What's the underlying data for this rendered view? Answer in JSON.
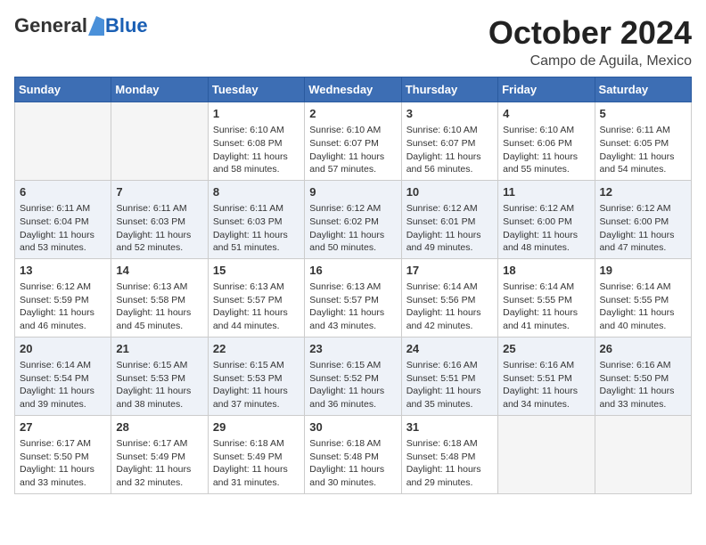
{
  "logo": {
    "general": "General",
    "blue": "Blue"
  },
  "header": {
    "month": "October 2024",
    "location": "Campo de Aguila, Mexico"
  },
  "days_of_week": [
    "Sunday",
    "Monday",
    "Tuesday",
    "Wednesday",
    "Thursday",
    "Friday",
    "Saturday"
  ],
  "weeks": [
    [
      {
        "day": "",
        "empty": true
      },
      {
        "day": "",
        "empty": true
      },
      {
        "day": "1",
        "sunrise": "Sunrise: 6:10 AM",
        "sunset": "Sunset: 6:08 PM",
        "daylight": "Daylight: 11 hours and 58 minutes."
      },
      {
        "day": "2",
        "sunrise": "Sunrise: 6:10 AM",
        "sunset": "Sunset: 6:07 PM",
        "daylight": "Daylight: 11 hours and 57 minutes."
      },
      {
        "day": "3",
        "sunrise": "Sunrise: 6:10 AM",
        "sunset": "Sunset: 6:07 PM",
        "daylight": "Daylight: 11 hours and 56 minutes."
      },
      {
        "day": "4",
        "sunrise": "Sunrise: 6:10 AM",
        "sunset": "Sunset: 6:06 PM",
        "daylight": "Daylight: 11 hours and 55 minutes."
      },
      {
        "day": "5",
        "sunrise": "Sunrise: 6:11 AM",
        "sunset": "Sunset: 6:05 PM",
        "daylight": "Daylight: 11 hours and 54 minutes."
      }
    ],
    [
      {
        "day": "6",
        "sunrise": "Sunrise: 6:11 AM",
        "sunset": "Sunset: 6:04 PM",
        "daylight": "Daylight: 11 hours and 53 minutes."
      },
      {
        "day": "7",
        "sunrise": "Sunrise: 6:11 AM",
        "sunset": "Sunset: 6:03 PM",
        "daylight": "Daylight: 11 hours and 52 minutes."
      },
      {
        "day": "8",
        "sunrise": "Sunrise: 6:11 AM",
        "sunset": "Sunset: 6:03 PM",
        "daylight": "Daylight: 11 hours and 51 minutes."
      },
      {
        "day": "9",
        "sunrise": "Sunrise: 6:12 AM",
        "sunset": "Sunset: 6:02 PM",
        "daylight": "Daylight: 11 hours and 50 minutes."
      },
      {
        "day": "10",
        "sunrise": "Sunrise: 6:12 AM",
        "sunset": "Sunset: 6:01 PM",
        "daylight": "Daylight: 11 hours and 49 minutes."
      },
      {
        "day": "11",
        "sunrise": "Sunrise: 6:12 AM",
        "sunset": "Sunset: 6:00 PM",
        "daylight": "Daylight: 11 hours and 48 minutes."
      },
      {
        "day": "12",
        "sunrise": "Sunrise: 6:12 AM",
        "sunset": "Sunset: 6:00 PM",
        "daylight": "Daylight: 11 hours and 47 minutes."
      }
    ],
    [
      {
        "day": "13",
        "sunrise": "Sunrise: 6:12 AM",
        "sunset": "Sunset: 5:59 PM",
        "daylight": "Daylight: 11 hours and 46 minutes."
      },
      {
        "day": "14",
        "sunrise": "Sunrise: 6:13 AM",
        "sunset": "Sunset: 5:58 PM",
        "daylight": "Daylight: 11 hours and 45 minutes."
      },
      {
        "day": "15",
        "sunrise": "Sunrise: 6:13 AM",
        "sunset": "Sunset: 5:57 PM",
        "daylight": "Daylight: 11 hours and 44 minutes."
      },
      {
        "day": "16",
        "sunrise": "Sunrise: 6:13 AM",
        "sunset": "Sunset: 5:57 PM",
        "daylight": "Daylight: 11 hours and 43 minutes."
      },
      {
        "day": "17",
        "sunrise": "Sunrise: 6:14 AM",
        "sunset": "Sunset: 5:56 PM",
        "daylight": "Daylight: 11 hours and 42 minutes."
      },
      {
        "day": "18",
        "sunrise": "Sunrise: 6:14 AM",
        "sunset": "Sunset: 5:55 PM",
        "daylight": "Daylight: 11 hours and 41 minutes."
      },
      {
        "day": "19",
        "sunrise": "Sunrise: 6:14 AM",
        "sunset": "Sunset: 5:55 PM",
        "daylight": "Daylight: 11 hours and 40 minutes."
      }
    ],
    [
      {
        "day": "20",
        "sunrise": "Sunrise: 6:14 AM",
        "sunset": "Sunset: 5:54 PM",
        "daylight": "Daylight: 11 hours and 39 minutes."
      },
      {
        "day": "21",
        "sunrise": "Sunrise: 6:15 AM",
        "sunset": "Sunset: 5:53 PM",
        "daylight": "Daylight: 11 hours and 38 minutes."
      },
      {
        "day": "22",
        "sunrise": "Sunrise: 6:15 AM",
        "sunset": "Sunset: 5:53 PM",
        "daylight": "Daylight: 11 hours and 37 minutes."
      },
      {
        "day": "23",
        "sunrise": "Sunrise: 6:15 AM",
        "sunset": "Sunset: 5:52 PM",
        "daylight": "Daylight: 11 hours and 36 minutes."
      },
      {
        "day": "24",
        "sunrise": "Sunrise: 6:16 AM",
        "sunset": "Sunset: 5:51 PM",
        "daylight": "Daylight: 11 hours and 35 minutes."
      },
      {
        "day": "25",
        "sunrise": "Sunrise: 6:16 AM",
        "sunset": "Sunset: 5:51 PM",
        "daylight": "Daylight: 11 hours and 34 minutes."
      },
      {
        "day": "26",
        "sunrise": "Sunrise: 6:16 AM",
        "sunset": "Sunset: 5:50 PM",
        "daylight": "Daylight: 11 hours and 33 minutes."
      }
    ],
    [
      {
        "day": "27",
        "sunrise": "Sunrise: 6:17 AM",
        "sunset": "Sunset: 5:50 PM",
        "daylight": "Daylight: 11 hours and 33 minutes."
      },
      {
        "day": "28",
        "sunrise": "Sunrise: 6:17 AM",
        "sunset": "Sunset: 5:49 PM",
        "daylight": "Daylight: 11 hours and 32 minutes."
      },
      {
        "day": "29",
        "sunrise": "Sunrise: 6:18 AM",
        "sunset": "Sunset: 5:49 PM",
        "daylight": "Daylight: 11 hours and 31 minutes."
      },
      {
        "day": "30",
        "sunrise": "Sunrise: 6:18 AM",
        "sunset": "Sunset: 5:48 PM",
        "daylight": "Daylight: 11 hours and 30 minutes."
      },
      {
        "day": "31",
        "sunrise": "Sunrise: 6:18 AM",
        "sunset": "Sunset: 5:48 PM",
        "daylight": "Daylight: 11 hours and 29 minutes."
      },
      {
        "day": "",
        "empty": true
      },
      {
        "day": "",
        "empty": true
      }
    ]
  ]
}
